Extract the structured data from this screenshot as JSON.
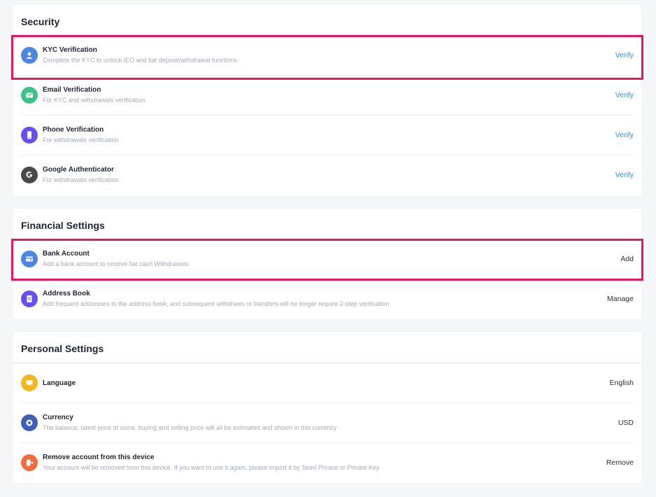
{
  "security": {
    "title": "Security",
    "items": [
      {
        "title": "KYC Verification",
        "desc": "Complete the KYC to unlock IEO and fiat deposit/withdrawal functions",
        "action": "Verify",
        "icon": "user-icon",
        "color": "#4c86e0"
      },
      {
        "title": "Email Verification",
        "desc": "For KYC and withdrawals verification",
        "action": "Verify",
        "icon": "mail-icon",
        "color": "#3dc38a"
      },
      {
        "title": "Phone Verification",
        "desc": "For withdrawals verification",
        "action": "Verify",
        "icon": "phone-icon",
        "color": "#6a4ff0"
      },
      {
        "title": "Google Authenticator",
        "desc": "For withdrawals verification",
        "action": "Verify",
        "icon": "google-icon",
        "color": "#4a4a4a"
      }
    ]
  },
  "financial": {
    "title": "Financial Settings",
    "items": [
      {
        "title": "Bank Account",
        "desc": "Add a bank account to receive fiat cash Withdrawals",
        "action": "Add",
        "icon": "bank-card-icon",
        "color": "#4c86e0"
      },
      {
        "title": "Address Book",
        "desc": "Add frequent addresses to the address book, and subsequent withdraws or transfers will no longer require 2-step verification",
        "action": "Manage",
        "icon": "address-book-icon",
        "color": "#6a4ff0"
      }
    ]
  },
  "personal": {
    "title": "Personal Settings",
    "items": [
      {
        "title": "Language",
        "desc": "",
        "action": "English",
        "icon": "language-icon",
        "color": "#f5b61e"
      },
      {
        "title": "Currency",
        "desc": "The balance, latest price of coins, buying and selling price will all be estimated and shown in this currency",
        "action": "USD",
        "icon": "currency-icon",
        "color": "#3f5fb8"
      },
      {
        "title": "Remove account from this device",
        "desc": "Your account will be removed from this device. If you want to use it again, please import it by Seed Phrase or Private Key",
        "action": "Remove",
        "icon": "remove-account-icon",
        "color": "#f26b3a"
      }
    ]
  },
  "colors": {
    "link": "#2d8fe0",
    "highlight": "#e8175d"
  }
}
